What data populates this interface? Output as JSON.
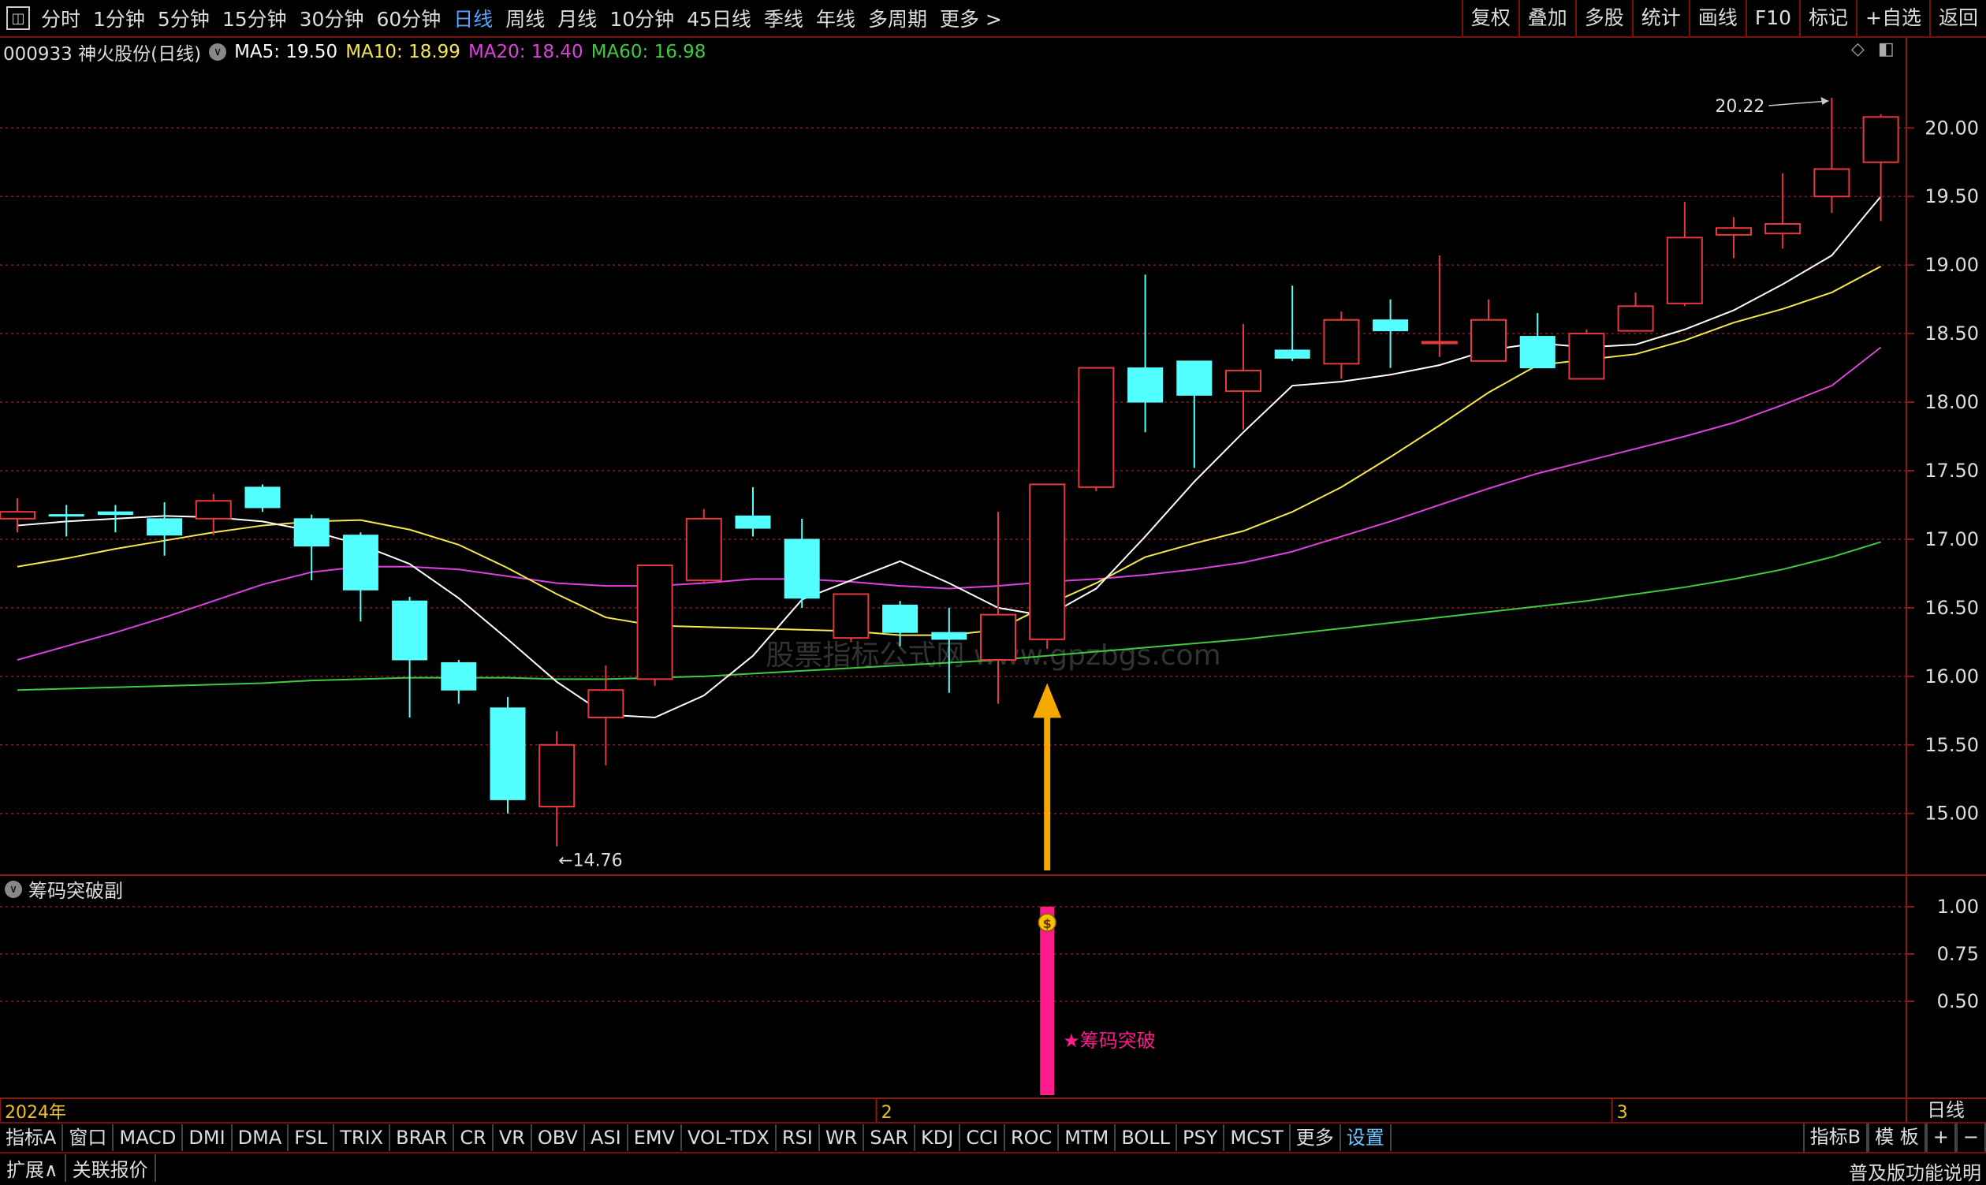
{
  "topbar": {
    "periods": [
      "分时",
      "1分钟",
      "5分钟",
      "15分钟",
      "30分钟",
      "60分钟",
      "日线",
      "周线",
      "月线",
      "10分钟",
      "45日线",
      "季线",
      "年线",
      "多周期",
      "更多 >"
    ],
    "active_period": "日线",
    "right_buttons": [
      "复权",
      "叠加",
      "多股",
      "统计",
      "画线",
      "F10",
      "标记",
      "+自选",
      "返回"
    ]
  },
  "info": {
    "stock": "000933 神火股份(日线)",
    "ma5": "MA5: 19.50",
    "ma10": "MA10: 18.99",
    "ma20": "MA20: 18.40",
    "ma60": "MA60: 16.98"
  },
  "subpanel": {
    "title": "筹码突破副",
    "signal_label": "★筹码突破",
    "yticks": [
      "1.00",
      "0.75",
      "0.50"
    ]
  },
  "chart_data": {
    "type": "candlestick",
    "ylim": [
      14.5,
      20.5
    ],
    "yticks": [
      "20.00",
      "19.50",
      "19.00",
      "18.50",
      "18.00",
      "17.50",
      "17.00",
      "16.50",
      "16.00",
      "15.50",
      "15.00"
    ],
    "candles": [
      {
        "o": 17.15,
        "h": 17.3,
        "l": 17.05,
        "c": 17.2
      },
      {
        "o": 17.18,
        "h": 17.25,
        "l": 17.02,
        "c": 17.17
      },
      {
        "o": 17.2,
        "h": 17.25,
        "l": 17.05,
        "c": 17.18
      },
      {
        "o": 17.15,
        "h": 17.27,
        "l": 16.88,
        "c": 17.03
      },
      {
        "o": 17.15,
        "h": 17.33,
        "l": 17.03,
        "c": 17.28
      },
      {
        "o": 17.38,
        "h": 17.4,
        "l": 17.2,
        "c": 17.23
      },
      {
        "o": 17.15,
        "h": 17.18,
        "l": 16.7,
        "c": 16.95
      },
      {
        "o": 17.03,
        "h": 17.05,
        "l": 16.4,
        "c": 16.63
      },
      {
        "o": 16.55,
        "h": 16.58,
        "l": 15.7,
        "c": 16.12
      },
      {
        "o": 16.1,
        "h": 16.12,
        "l": 15.8,
        "c": 15.9
      },
      {
        "o": 15.77,
        "h": 15.85,
        "l": 15.0,
        "c": 15.1
      },
      {
        "o": 15.05,
        "h": 15.6,
        "l": 14.76,
        "c": 15.5
      },
      {
        "o": 15.7,
        "h": 16.08,
        "l": 15.35,
        "c": 15.9
      },
      {
        "o": 15.98,
        "h": 16.81,
        "l": 15.93,
        "c": 16.81
      },
      {
        "o": 16.7,
        "h": 17.22,
        "l": 16.68,
        "c": 17.15
      },
      {
        "o": 17.17,
        "h": 17.38,
        "l": 17.02,
        "c": 17.08
      },
      {
        "o": 17.0,
        "h": 17.15,
        "l": 16.5,
        "c": 16.57
      },
      {
        "o": 16.28,
        "h": 16.6,
        "l": 16.25,
        "c": 16.6
      },
      {
        "o": 16.52,
        "h": 16.55,
        "l": 16.22,
        "c": 16.32
      },
      {
        "o": 16.32,
        "h": 16.5,
        "l": 15.88,
        "c": 16.27
      },
      {
        "o": 16.12,
        "h": 17.2,
        "l": 15.8,
        "c": 16.45
      },
      {
        "o": 16.27,
        "h": 17.4,
        "l": 16.2,
        "c": 17.4
      },
      {
        "o": 17.38,
        "h": 18.25,
        "l": 17.35,
        "c": 18.25
      },
      {
        "o": 18.25,
        "h": 18.93,
        "l": 17.78,
        "c": 18.0
      },
      {
        "o": 18.3,
        "h": 18.3,
        "l": 17.52,
        "c": 18.05
      },
      {
        "o": 18.08,
        "h": 18.57,
        "l": 17.8,
        "c": 18.23
      },
      {
        "o": 18.38,
        "h": 18.85,
        "l": 18.3,
        "c": 18.32
      },
      {
        "o": 18.28,
        "h": 18.66,
        "l": 18.17,
        "c": 18.6
      },
      {
        "o": 18.6,
        "h": 18.75,
        "l": 18.25,
        "c": 18.52
      },
      {
        "o": 18.44,
        "h": 19.07,
        "l": 18.33,
        "c": 18.44
      },
      {
        "o": 18.3,
        "h": 18.75,
        "l": 18.3,
        "c": 18.6
      },
      {
        "o": 18.48,
        "h": 18.65,
        "l": 18.25,
        "c": 18.25
      },
      {
        "o": 18.17,
        "h": 18.53,
        "l": 18.17,
        "c": 18.5
      },
      {
        "o": 18.52,
        "h": 18.8,
        "l": 18.52,
        "c": 18.7
      },
      {
        "o": 18.72,
        "h": 19.46,
        "l": 18.7,
        "c": 19.2
      },
      {
        "o": 19.22,
        "h": 19.35,
        "l": 19.05,
        "c": 19.27
      },
      {
        "o": 19.23,
        "h": 19.67,
        "l": 19.12,
        "c": 19.3
      },
      {
        "o": 19.5,
        "h": 20.22,
        "l": 19.38,
        "c": 19.7
      },
      {
        "o": 19.75,
        "h": 20.1,
        "l": 19.32,
        "c": 20.08
      }
    ],
    "ma5": [
      17.1,
      17.13,
      17.15,
      17.17,
      17.16,
      17.13,
      17.06,
      16.96,
      16.82,
      16.57,
      16.27,
      15.96,
      15.72,
      15.7,
      15.86,
      16.15,
      16.56,
      16.7,
      16.84,
      16.68,
      16.5,
      16.44,
      16.64,
      17.02,
      17.42,
      17.78,
      18.12,
      18.15,
      18.2,
      18.27,
      18.38,
      18.43,
      18.4,
      18.42,
      18.53,
      18.67,
      18.86,
      19.07,
      19.5
    ],
    "ma10": [
      16.8,
      16.86,
      16.93,
      16.99,
      17.05,
      17.1,
      17.13,
      17.14,
      17.07,
      16.96,
      16.79,
      16.6,
      16.43,
      16.37,
      16.36,
      16.35,
      16.34,
      16.33,
      16.3,
      16.3,
      16.34,
      16.52,
      16.68,
      16.87,
      16.97,
      17.06,
      17.2,
      17.38,
      17.6,
      17.83,
      18.07,
      18.27,
      18.31,
      18.35,
      18.45,
      18.58,
      18.68,
      18.8,
      18.99
    ],
    "ma20": [
      16.12,
      16.22,
      16.32,
      16.43,
      16.55,
      16.67,
      16.76,
      16.8,
      16.8,
      16.78,
      16.73,
      16.68,
      16.66,
      16.66,
      16.68,
      16.71,
      16.71,
      16.69,
      16.66,
      16.64,
      16.66,
      16.69,
      16.71,
      16.74,
      16.78,
      16.83,
      16.91,
      17.02,
      17.13,
      17.25,
      17.37,
      17.48,
      17.57,
      17.66,
      17.75,
      17.85,
      17.98,
      18.12,
      18.4
    ],
    "ma60": [
      15.9,
      15.91,
      15.92,
      15.93,
      15.94,
      15.95,
      15.97,
      15.98,
      15.99,
      15.99,
      15.99,
      15.98,
      15.98,
      15.99,
      16.0,
      16.02,
      16.04,
      16.06,
      16.08,
      16.1,
      16.12,
      16.15,
      16.18,
      16.21,
      16.24,
      16.27,
      16.31,
      16.35,
      16.39,
      16.43,
      16.47,
      16.51,
      16.55,
      16.6,
      16.65,
      16.71,
      16.78,
      16.87,
      16.98
    ],
    "high_label": "20.22",
    "low_label": "14.76",
    "signal_index": 21,
    "xlabels": [
      {
        "i": 0,
        "text": "2024年"
      },
      {
        "i": 18,
        "text": "2"
      },
      {
        "i": 33,
        "text": "3"
      }
    ],
    "watermark": "股票指标公式网 www.gpzbgs.com"
  },
  "indicators": [
    "指标A",
    "窗口",
    "MACD",
    "DMI",
    "DMA",
    "FSL",
    "TRIX",
    "BRAR",
    "CR",
    "VR",
    "OBV",
    "ASI",
    "EMV",
    "VOL-TDX",
    "RSI",
    "WR",
    "SAR",
    "KDJ",
    "CCI",
    "ROC",
    "MTM",
    "BOLL",
    "PSY",
    "MCST",
    "更多",
    "设置"
  ],
  "indicators_active": "设置",
  "indicators_right": [
    "指标B",
    "模 板",
    "+",
    "−"
  ],
  "right_period_label": "日线",
  "footer": {
    "expand": "扩展∧",
    "related": "关联报价",
    "right": "普及版功能说明"
  },
  "colors": {
    "up": "#e8383d",
    "down": "#54ffff",
    "ma5": "#ffffff",
    "ma10": "#f5e84a",
    "ma20": "#e040e0",
    "ma60": "#3ecb3e",
    "grid": "#8b1a1a",
    "signal": "#ff1a8c",
    "arrow": "#f5a800"
  }
}
